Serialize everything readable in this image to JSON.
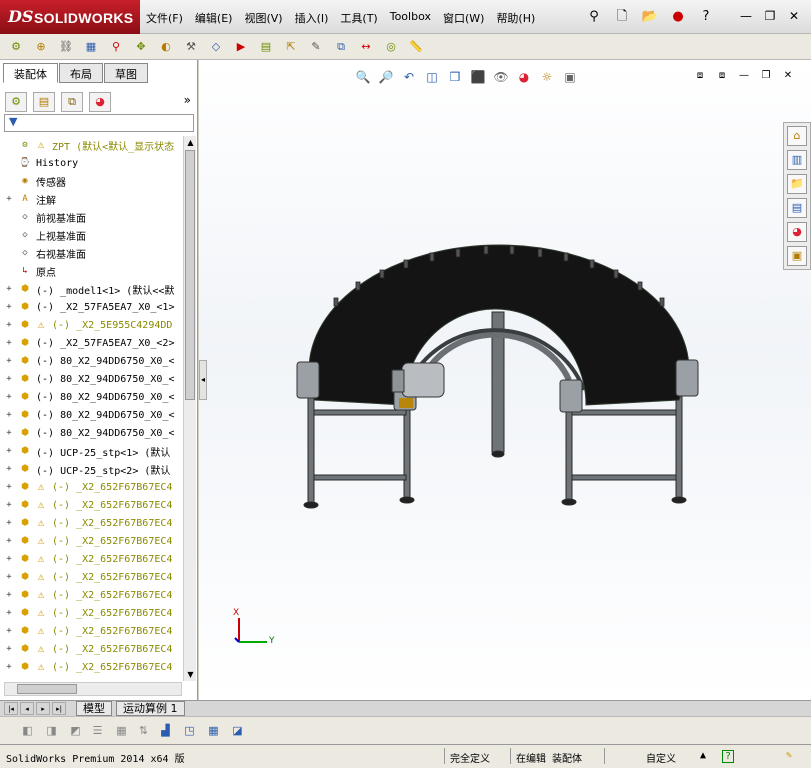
{
  "app": {
    "logo_ds": "DS",
    "logo_text": "SOLIDWORKS"
  },
  "menu": [
    "文件(F)",
    "编辑(E)",
    "视图(V)",
    "插入(I)",
    "工具(T)",
    "Toolbox",
    "窗口(W)",
    "帮助(H)"
  ],
  "top_icons": [
    "pin-icon",
    "new-document-icon",
    "open-folder-icon",
    "traffic-light-icon",
    "help-icon"
  ],
  "window_buttons": [
    "minimize",
    "restore",
    "close"
  ],
  "command_icons": [
    "assembly-icon",
    "insert-component-icon",
    "mate-icon",
    "linear-pattern-icon",
    "smart-fasteners-icon",
    "move-component-icon",
    "show-hidden-icon",
    "assembly-features-icon",
    "reference-geometry-icon",
    "new-motion-study-icon",
    "bill-of-materials-icon",
    "exploded-view-icon",
    "explode-line-sketch-icon",
    "interference-detection-icon",
    "clearance-icon",
    "hole-alignment-icon",
    "measure-icon"
  ],
  "left": {
    "tabs": [
      "装配体",
      "布局",
      "草图"
    ],
    "fm_tabs": [
      "featuremanager-icon",
      "propertymanager-icon",
      "configurationmanager-icon",
      "appearance-icon"
    ],
    "more": "»",
    "filter": "▼",
    "tree": [
      {
        "expander": "",
        "icon": "assembly",
        "warn": true,
        "label": "ZPT  (默认<默认_显示状态",
        "cls": "top"
      },
      {
        "expander": "",
        "icon": "history",
        "warn": false,
        "label": "History",
        "cls": ""
      },
      {
        "expander": "",
        "icon": "sensor",
        "warn": false,
        "label": "传感器",
        "cls": ""
      },
      {
        "expander": "+",
        "icon": "annotation",
        "warn": false,
        "label": "注解",
        "cls": ""
      },
      {
        "expander": "",
        "icon": "plane",
        "warn": false,
        "label": "前视基准面",
        "cls": ""
      },
      {
        "expander": "",
        "icon": "plane",
        "warn": false,
        "label": "上视基准面",
        "cls": ""
      },
      {
        "expander": "",
        "icon": "plane",
        "warn": false,
        "label": "右视基准面",
        "cls": ""
      },
      {
        "expander": "",
        "icon": "origin",
        "warn": false,
        "label": "原点",
        "cls": ""
      },
      {
        "expander": "+",
        "icon": "part",
        "warn": false,
        "label": "(-) _model1<1> (默认<<默",
        "cls": ""
      },
      {
        "expander": "+",
        "icon": "part",
        "warn": false,
        "label": "(-) _X2_57FA5EA7_X0_<1>",
        "cls": ""
      },
      {
        "expander": "+",
        "icon": "part",
        "warn": true,
        "label": "(-) _X2_5E955C4294DD",
        "cls": "warnrow"
      },
      {
        "expander": "+",
        "icon": "part",
        "warn": false,
        "label": "(-) _X2_57FA5EA7_X0_<2>",
        "cls": ""
      },
      {
        "expander": "+",
        "icon": "part",
        "warn": false,
        "label": "(-) 80_X2_94DD6750_X0_<",
        "cls": ""
      },
      {
        "expander": "+",
        "icon": "part",
        "warn": false,
        "label": "(-) 80_X2_94DD6750_X0_<",
        "cls": ""
      },
      {
        "expander": "+",
        "icon": "part",
        "warn": false,
        "label": "(-) 80_X2_94DD6750_X0_<",
        "cls": ""
      },
      {
        "expander": "+",
        "icon": "part",
        "warn": false,
        "label": "(-) 80_X2_94DD6750_X0_<",
        "cls": ""
      },
      {
        "expander": "+",
        "icon": "part",
        "warn": false,
        "label": "(-) 80_X2_94DD6750_X0_<",
        "cls": ""
      },
      {
        "expander": "+",
        "icon": "part",
        "warn": false,
        "label": "(-) UCP-25_stp<1> (默认",
        "cls": ""
      },
      {
        "expander": "+",
        "icon": "part",
        "warn": false,
        "label": "(-) UCP-25_stp<2> (默认",
        "cls": ""
      },
      {
        "expander": "+",
        "icon": "part",
        "warn": true,
        "label": "(-) _X2_652F67B67EC4",
        "cls": "warnrow"
      },
      {
        "expander": "+",
        "icon": "part",
        "warn": true,
        "label": "(-) _X2_652F67B67EC4",
        "cls": "warnrow"
      },
      {
        "expander": "+",
        "icon": "part",
        "warn": true,
        "label": "(-) _X2_652F67B67EC4",
        "cls": "warnrow"
      },
      {
        "expander": "+",
        "icon": "part",
        "warn": true,
        "label": "(-) _X2_652F67B67EC4",
        "cls": "warnrow"
      },
      {
        "expander": "+",
        "icon": "part",
        "warn": true,
        "label": "(-) _X2_652F67B67EC4",
        "cls": "warnrow"
      },
      {
        "expander": "+",
        "icon": "part",
        "warn": true,
        "label": "(-) _X2_652F67B67EC4",
        "cls": "warnrow"
      },
      {
        "expander": "+",
        "icon": "part",
        "warn": true,
        "label": "(-) _X2_652F67B67EC4",
        "cls": "warnrow"
      },
      {
        "expander": "+",
        "icon": "part",
        "warn": true,
        "label": "(-) _X2_652F67B67EC4",
        "cls": "warnrow"
      },
      {
        "expander": "+",
        "icon": "part",
        "warn": true,
        "label": "(-) _X2_652F67B67EC4",
        "cls": "warnrow"
      },
      {
        "expander": "+",
        "icon": "part",
        "warn": true,
        "label": "(-) _X2_652F67B67EC4",
        "cls": "warnrow"
      },
      {
        "expander": "+",
        "icon": "part",
        "warn": true,
        "label": "(-) _X2_652F67B67EC4",
        "cls": "warnrow"
      }
    ]
  },
  "graphics": {
    "headsup_icons": [
      "zoom-to-fit-icon",
      "zoom-to-area-icon",
      "previous-view-icon",
      "section-view-icon",
      "view-orientation-icon",
      "display-style-icon",
      "hide-show-items-icon",
      "edit-appearance-icon",
      "apply-scene-icon",
      "view-settings-icon"
    ],
    "task_icons": [
      "home-icon",
      "design-library-icon",
      "file-explorer-icon",
      "view-palette-icon",
      "appearances-icon",
      "custom-properties-icon"
    ],
    "triad_x": "X",
    "triad_y": "Y"
  },
  "bottom_tabs": [
    "模型",
    "运动算例 1"
  ],
  "view_icons": [
    "view-icon-1",
    "view-icon-2",
    "view-icon-3",
    "view-icon-4",
    "view-icon-5",
    "view-icon-6",
    "view-icon-7",
    "view-icon-8",
    "view-icon-9",
    "view-icon-10"
  ],
  "status": {
    "product": "SolidWorks Premium 2014 x64 版",
    "state": "完全定义",
    "editing": "在编辑 装配体",
    "units": "自定义",
    "up": "▲",
    "help": "?"
  },
  "colors": {
    "brand_red": "#c8202a",
    "warning": "#d49c00",
    "belt": "#141414",
    "frame": "#7a7f85"
  }
}
